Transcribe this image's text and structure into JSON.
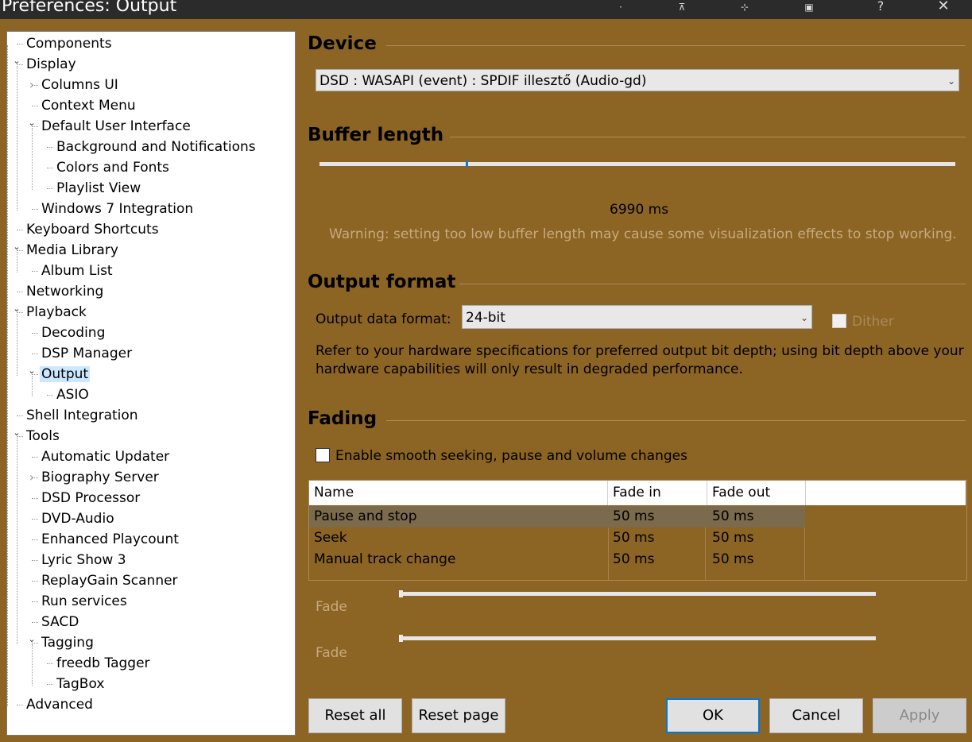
{
  "window": {
    "title": "Preferences: Output",
    "help_label": "?",
    "close_label": "✕"
  },
  "tree": {
    "items": [
      {
        "label": "Components",
        "level": 0
      },
      {
        "label": "Display",
        "level": 0,
        "expanded": true
      },
      {
        "label": "Columns UI",
        "level": 1,
        "collapsed": true
      },
      {
        "label": "Context Menu",
        "level": 1
      },
      {
        "label": "Default User Interface",
        "level": 1,
        "expanded": true
      },
      {
        "label": "Background and Notifications",
        "level": 2
      },
      {
        "label": "Colors and Fonts",
        "level": 2
      },
      {
        "label": "Playlist View",
        "level": 2
      },
      {
        "label": "Windows 7 Integration",
        "level": 1
      },
      {
        "label": "Keyboard Shortcuts",
        "level": 0
      },
      {
        "label": "Media Library",
        "level": 0,
        "expanded": true
      },
      {
        "label": "Album List",
        "level": 1
      },
      {
        "label": "Networking",
        "level": 0
      },
      {
        "label": "Playback",
        "level": 0,
        "expanded": true
      },
      {
        "label": "Decoding",
        "level": 1
      },
      {
        "label": "DSP Manager",
        "level": 1
      },
      {
        "label": "Output",
        "level": 1,
        "expanded": true,
        "selected": true
      },
      {
        "label": "ASIO",
        "level": 2
      },
      {
        "label": "Shell Integration",
        "level": 0
      },
      {
        "label": "Tools",
        "level": 0,
        "expanded": true
      },
      {
        "label": "Automatic Updater",
        "level": 1
      },
      {
        "label": "Biography Server",
        "level": 1,
        "collapsed": true
      },
      {
        "label": "DSD Processor",
        "level": 1
      },
      {
        "label": "DVD-Audio",
        "level": 1
      },
      {
        "label": "Enhanced Playcount",
        "level": 1
      },
      {
        "label": "Lyric Show 3",
        "level": 1
      },
      {
        "label": "ReplayGain Scanner",
        "level": 1
      },
      {
        "label": "Run services",
        "level": 1
      },
      {
        "label": "SACD",
        "level": 1
      },
      {
        "label": "Tagging",
        "level": 1,
        "expanded": true
      },
      {
        "label": "freedb Tagger",
        "level": 2
      },
      {
        "label": "TagBox",
        "level": 2
      },
      {
        "label": "Advanced",
        "level": 0
      }
    ]
  },
  "device": {
    "section_title": "Device",
    "selected": "DSD : WASAPI (event) : SPDIF illesztő (Audio-gd)"
  },
  "buffer": {
    "section_title": "Buffer length",
    "value_label": "6990 ms",
    "slider_fraction": 0.23,
    "warning": "Warning: setting too low buffer length may cause some visualization effects to stop working."
  },
  "output_format": {
    "section_title": "Output format",
    "label": "Output data format:",
    "selected": "24-bit",
    "dither_label": "Dither",
    "note_line1": "Refer to your hardware specifications for preferred output bit depth; using bit depth above your",
    "note_line2": "hardware capabilities will only result in degraded performance."
  },
  "fading": {
    "section_title": "Fading",
    "checkbox_label": "Enable smooth seeking, pause and volume changes",
    "columns": [
      "Name",
      "Fade in",
      "Fade out"
    ],
    "rows": [
      {
        "name": "Pause and stop",
        "fade_in": "50 ms",
        "fade_out": "50 ms"
      },
      {
        "name": "Seek",
        "fade_in": "50 ms",
        "fade_out": "50 ms"
      },
      {
        "name": "Manual track change",
        "fade_in": "50 ms",
        "fade_out": "50 ms"
      }
    ],
    "fade_label_1": "Fade",
    "fade_label_2": "Fade"
  },
  "buttons": {
    "reset_all": "Reset all",
    "reset_page": "Reset page",
    "ok": "OK",
    "cancel": "Cancel",
    "apply": "Apply"
  },
  "colors": {
    "panel_bg": "#8c6423",
    "selection": "#cce8ff",
    "accent": "#0078d7"
  }
}
